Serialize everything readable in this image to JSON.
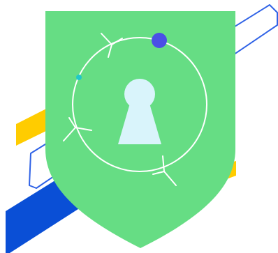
{
  "illustration": {
    "icon": "security-shield-lock-icon",
    "colors": {
      "background": "#ffffff",
      "shield": "#66dd84",
      "line": "#ffffff",
      "keyhole": "#d9f4fb",
      "accent_blue": "#0a4fd6",
      "outline_blue": "#2f62e6",
      "yellow": "#ffcc00",
      "orbit_dot_blue": "#4a4fe6",
      "orbit_dot_teal": "#20c8c8"
    }
  }
}
